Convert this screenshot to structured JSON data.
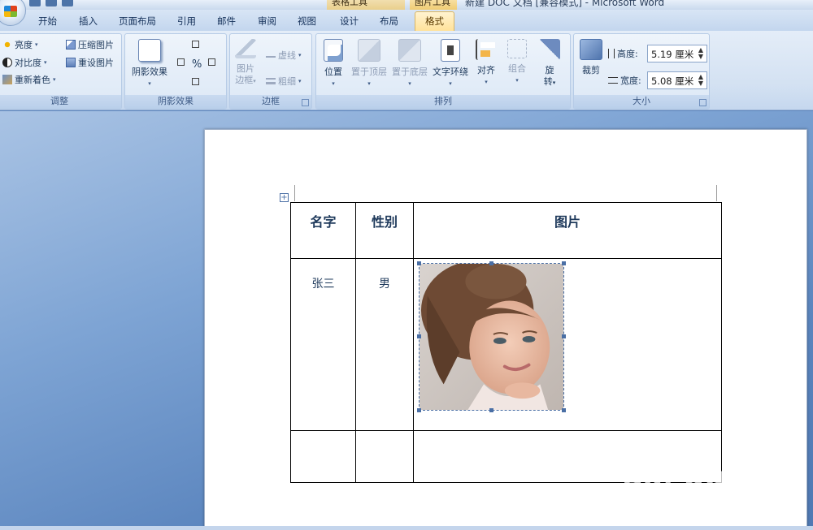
{
  "window": {
    "title": "新建 DOC 文档 [兼容模式] - Microsoft Word",
    "context_tab_table": "表格工具",
    "context_tab_picture": "图片工具"
  },
  "tabs": [
    "开始",
    "插入",
    "页面布局",
    "引用",
    "邮件",
    "审阅",
    "视图",
    "设计",
    "布局",
    "格式"
  ],
  "active_tab": "格式",
  "ribbon": {
    "adjust": {
      "label": "调整",
      "brightness": "亮度",
      "contrast": "对比度",
      "recolor": "重新着色",
      "compress": "压缩图片",
      "reset": "重设图片"
    },
    "shadow": {
      "label": "阴影效果",
      "shadow_effects": "阴影效果"
    },
    "border": {
      "label": "边框",
      "picture_border_1": "图片",
      "picture_border_2": "边框",
      "dashes": "虚线",
      "weight": "粗细"
    },
    "arrange": {
      "label": "排列",
      "position": "位置",
      "bring_front": "置于顶层",
      "send_back": "置于底层",
      "text_wrap": "文字环绕",
      "align": "对齐",
      "group": "组合",
      "rotate_1": "旋",
      "rotate_2": "转"
    },
    "size": {
      "label": "大小",
      "crop": "裁剪",
      "height_label": "高度:",
      "height_value": "5.19 厘米",
      "width_label": "宽度:",
      "width_value": "5.08 厘米"
    }
  },
  "document": {
    "table": {
      "headers": [
        "名字",
        "性别",
        "图片"
      ],
      "rows": [
        [
          "张三",
          "男",
          ""
        ],
        [
          "",
          "",
          ""
        ]
      ]
    }
  },
  "watermark": {
    "brand": "Bai du 经验",
    "url": "jingyan.baidu.com"
  },
  "colors": {
    "active_tab": "#ffe29a",
    "ribbon": "#dce8f6",
    "workspace": "#5b85be"
  }
}
